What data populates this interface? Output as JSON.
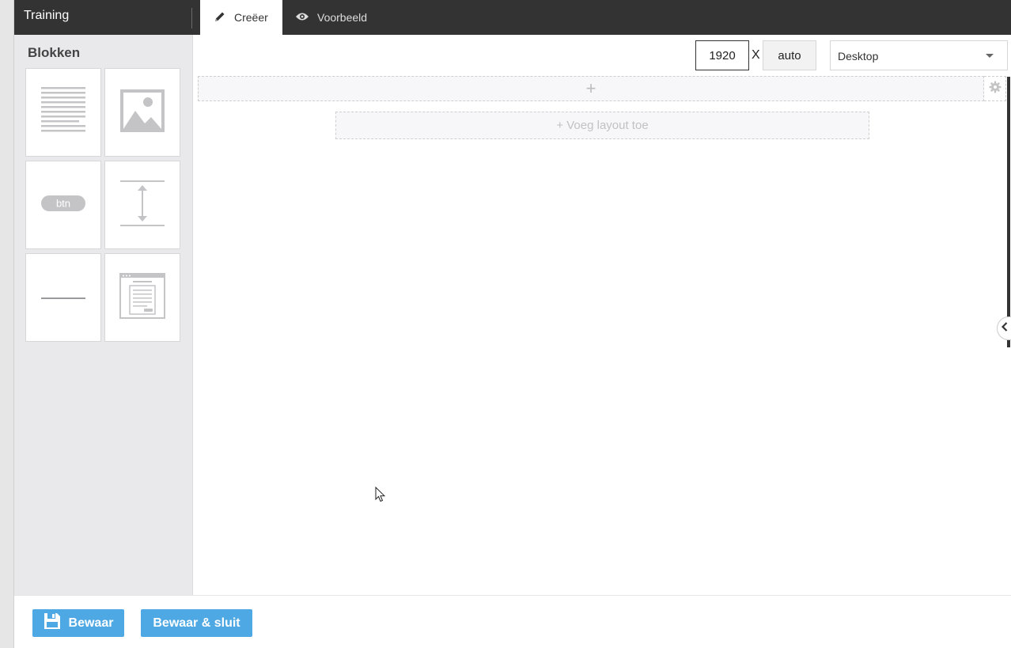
{
  "app": {
    "title": "Training"
  },
  "tabs": [
    {
      "label": "Creëer",
      "icon": "pencil-icon",
      "active": true
    },
    {
      "label": "Voorbeeld",
      "icon": "eye-icon",
      "active": false
    }
  ],
  "sidebar": {
    "title": "Blokken",
    "blocks": [
      {
        "name": "text-block",
        "icon": "text-lines-icon"
      },
      {
        "name": "image-block",
        "icon": "image-icon"
      },
      {
        "name": "button-block",
        "icon": "button-icon",
        "label": "btn"
      },
      {
        "name": "spacer-block",
        "icon": "spacer-arrows-icon"
      },
      {
        "name": "divider-block",
        "icon": "divider-line-icon"
      },
      {
        "name": "html-block",
        "icon": "web-page-icon"
      }
    ]
  },
  "canvas": {
    "width_value": "1920",
    "separator": "X",
    "height_value": "auto",
    "device": {
      "selected": "Desktop"
    },
    "row_add_label": "+",
    "add_layout_label": "+ Voeg layout toe"
  },
  "footer": {
    "save_label": "Bewaar",
    "save_close_label": "Bewaar & sluit"
  },
  "colors": {
    "topbar": "#333333",
    "sidebar": "#e9e8ea",
    "button": "#4ea8e3"
  }
}
